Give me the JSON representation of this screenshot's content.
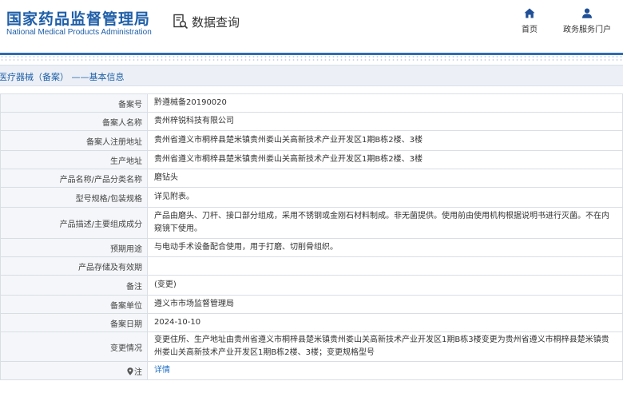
{
  "header": {
    "logo_cn": "国家药品监督管理局",
    "logo_en": "National Medical Products Administration",
    "query_label": "数据查询",
    "nav": {
      "home": "首页",
      "portal": "政务服务门户"
    }
  },
  "breadcrumb": "医疗器械（备案） ——基本信息",
  "detail": {
    "rows": [
      {
        "label": "备案号",
        "value": "黔遵械备20190020"
      },
      {
        "label": "备案人名称",
        "value": "贵州梓锐科技有限公司"
      },
      {
        "label": "备案人注册地址",
        "value": "贵州省遵义市桐梓县楚米镇贵州娄山关高新技术产业开发区1期B栋2楼、3楼"
      },
      {
        "label": "生产地址",
        "value": "贵州省遵义市桐梓县楚米镇贵州娄山关高新技术产业开发区1期B栋2楼、3楼"
      },
      {
        "label": "产品名称/产品分类名称",
        "value": "磨钻头"
      },
      {
        "label": "型号规格/包装规格",
        "value": "详见附表。"
      },
      {
        "label": "产品描述/主要组成成分",
        "value": "产品由磨头、刀杆、接口部分组成，采用不锈钢或金刚石材料制成。非无菌提供。使用前由使用机构根据说明书进行灭菌。不在内窥镜下使用。"
      },
      {
        "label": "预期用途",
        "value": "与电动手术设备配合使用，用于打磨、切削骨组织。"
      },
      {
        "label": "产品存储及有效期",
        "value": ""
      },
      {
        "label": "备注",
        "value": "(变更)"
      },
      {
        "label": "备案单位",
        "value": "遵义市市场监督管理局"
      },
      {
        "label": "备案日期",
        "value": "2024-10-10"
      },
      {
        "label": "变更情况",
        "value": "变更住所、生产地址由贵州省遵义市桐梓县楚米镇贵州娄山关高新技术产业开发区1期B栋3楼变更为贵州省遵义市桐梓县楚米镇贵州娄山关高新技术产业开发区1期B栋2楼、3楼；变更规格型号"
      },
      {
        "label": "注",
        "value": "详情"
      }
    ]
  },
  "colors": {
    "brand_blue": "#1f5fa8",
    "link_blue": "#1f6fc5",
    "label_bg": "#f4f6f9",
    "crumb_bg": "#ecf0f6"
  },
  "icons": {
    "query": "document-search-icon",
    "home": "home-icon",
    "portal": "user-icon",
    "note": "location-pin-icon"
  }
}
